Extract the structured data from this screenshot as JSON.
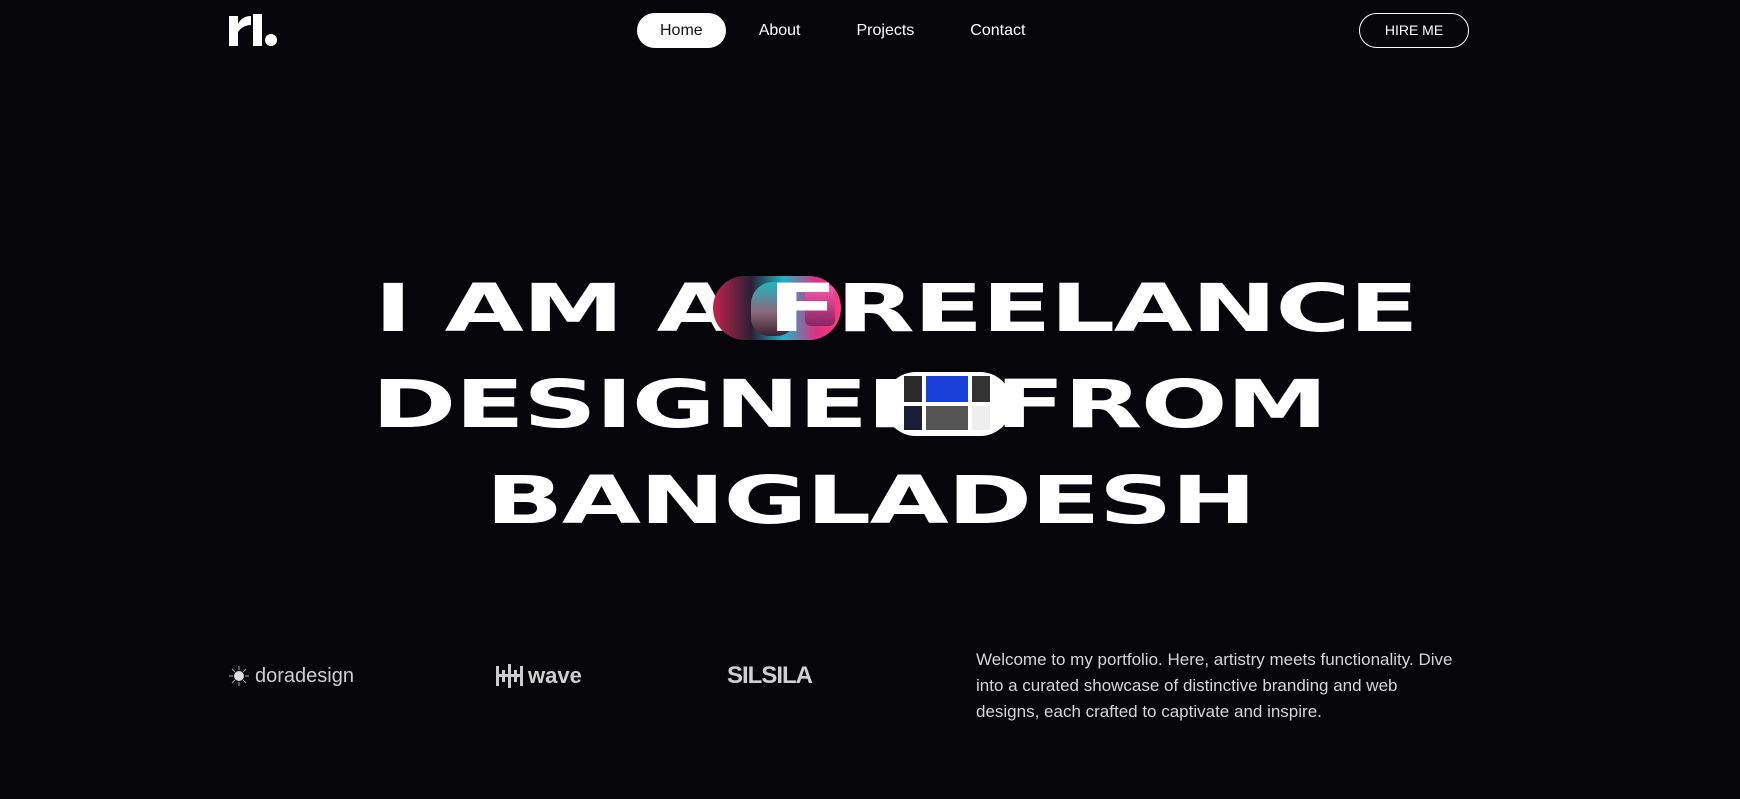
{
  "header": {
    "nav": [
      {
        "label": "Home",
        "active": true
      },
      {
        "label": "About",
        "active": false
      },
      {
        "label": "Projects",
        "active": false
      },
      {
        "label": "Contact",
        "active": false
      }
    ],
    "hire_label": "HIRE ME"
  },
  "hero": {
    "line1_a": "I AM A",
    "line1_b": "FREELANCE",
    "line2_a": "DESIGNER",
    "line2_b": "FROM",
    "line3": "BANGLADESH"
  },
  "clients": {
    "brand1": "doradesign",
    "brand2": "wave",
    "brand3": "SILSILA"
  },
  "intro": "Welcome to my portfolio. Here, artistry meets functionality. Dive into a curated showcase of distinctive branding and web designs, each crafted to captivate and inspire.",
  "colors": {
    "background": "#05050a",
    "text": "#ffffff",
    "muted": "#d6d6d6"
  },
  "icons": [
    "logo-mark-icon",
    "doradesign-logo",
    "wave-logo",
    "silsila-logo"
  ]
}
